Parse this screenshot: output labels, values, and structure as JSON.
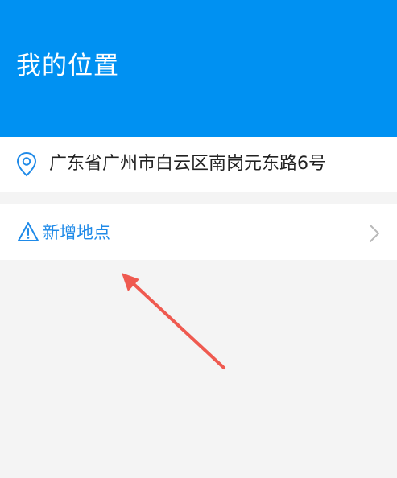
{
  "header": {
    "title": "我的位置",
    "background_color": "#0091f2"
  },
  "current_location": {
    "icon": "location-pin-icon",
    "address": "广东省广州市白云区南岗元东路6号"
  },
  "add_location": {
    "icon": "warning-triangle-icon",
    "label": "新增地点",
    "accent_color": "#1f8ae8",
    "chevron_icon": "chevron-right-icon"
  },
  "annotation": {
    "type": "red-arrow",
    "color": "#ef5a50"
  }
}
